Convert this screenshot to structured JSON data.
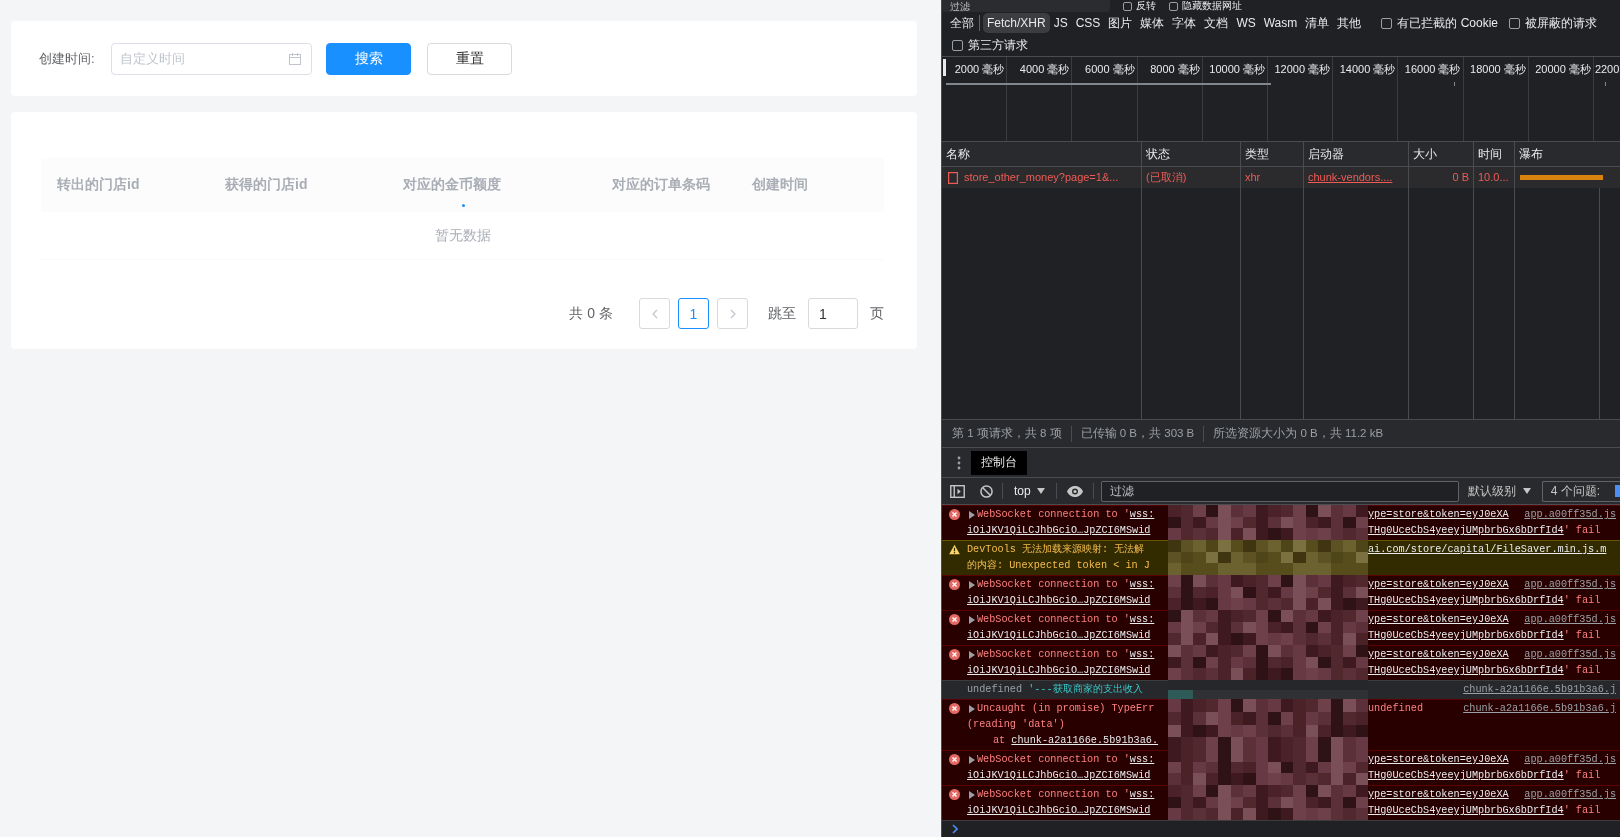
{
  "page": {
    "filter": {
      "label": "创建时间:",
      "date_placeholder": "自定义时间",
      "search_button": "搜索",
      "reset_button": "重置"
    },
    "table": {
      "loading": true,
      "columns": [
        "转出的门店id",
        "获得的门店id",
        "对应的金币额度",
        "对应的订单条码",
        "创建时间"
      ],
      "empty_text": "暂无数据"
    },
    "pagination": {
      "total": "共 0 条",
      "prev_disabled": true,
      "next_disabled": true,
      "pages": [
        {
          "label": "1",
          "selected": true
        }
      ],
      "jump_label": "跳至",
      "jump_value": "1",
      "page_suffix": "页"
    }
  },
  "devtools": {
    "network": {
      "filter_placeholder": "过滤",
      "top_checkboxes": [
        {
          "label": "反转",
          "checked": false
        },
        {
          "label": "隐藏数据网址",
          "checked": false
        }
      ],
      "type_filters": [
        {
          "label": "全部",
          "selected": false
        },
        {
          "label": "Fetch/XHR",
          "selected": true
        },
        {
          "label": "JS",
          "selected": false
        },
        {
          "label": "CSS",
          "selected": false
        },
        {
          "label": "图片",
          "selected": false
        },
        {
          "label": "媒体",
          "selected": false
        },
        {
          "label": "字体",
          "selected": false
        },
        {
          "label": "文档",
          "selected": false
        },
        {
          "label": "WS",
          "selected": false
        },
        {
          "label": "Wasm",
          "selected": false
        },
        {
          "label": "清单",
          "selected": false
        },
        {
          "label": "其他",
          "selected": false
        }
      ],
      "option_checkboxes": [
        {
          "label": "有已拦截的 Cookie",
          "checked": false
        },
        {
          "label": "被屏蔽的请求",
          "checked": false
        }
      ],
      "second_row_checkboxes": [
        {
          "label": "第三方请求",
          "checked": false
        }
      ],
      "timeline_ticks": [
        "2000 毫秒",
        "4000 毫秒",
        "6000 毫秒",
        "8000 毫秒",
        "10000 毫秒",
        "12000 毫秒",
        "14000 毫秒",
        "16000 毫秒",
        "18000 毫秒",
        "20000 毫秒",
        "2200"
      ],
      "columns": [
        "名称",
        "状态",
        "类型",
        "启动器",
        "大小",
        "时间",
        "瀑布"
      ],
      "requests": [
        {
          "name": "store_other_money?page=1&...",
          "status": "(已取消)",
          "type": "xhr",
          "initiator": "chunk-vendors....",
          "size": "0 B",
          "time": "10.0...",
          "failed": true
        }
      ],
      "status_bar": [
        "第 1 项请求，共 8 项",
        "已传输 0 B，共 303 B",
        "所选资源大小为 0 B，共 11.2 kB"
      ]
    },
    "drawer_tabs": [
      {
        "label": "控制台",
        "selected": true
      }
    ],
    "console": {
      "context": "top",
      "filter_placeholder": "过滤",
      "level": "默认级别",
      "issues": "4 个问题:",
      "messages": [
        {
          "kind": "error",
          "expandable": true,
          "redacted": true,
          "source": "app.a00ff35d.js",
          "lines": [
            {
              "before": [
                {
                  "kind": "text",
                  "text": "WebSocket connection to '"
                },
                {
                  "kind": "link",
                  "text": "wss:"
                }
              ],
              "after": [
                {
                  "kind": "link",
                  "text": "ype=store&token=eyJ0eXA"
                }
              ]
            },
            {
              "before": [
                {
                  "kind": "link",
                  "text": "iOiJKV1QiLCJhbGciO…JpZCI6MSwid"
                }
              ],
              "after": [
                {
                  "kind": "link",
                  "text": "THg0UceCbS4yeeyjUMpbrbGx6bDrfId4"
                },
                {
                  "kind": "text",
                  "text": "' fail"
                }
              ]
            }
          ]
        },
        {
          "kind": "warning",
          "expandable": false,
          "redacted": true,
          "lines": [
            {
              "before": [
                {
                  "kind": "text",
                  "text": "DevTools 无法加载来源映射: 无法解"
                }
              ],
              "after": [
                {
                  "kind": "link",
                  "text": "ai.com/store/capital/FileSaver.min.js.m"
                }
              ]
            },
            {
              "before": [
                {
                  "kind": "text",
                  "text": "的内容: Unexpected token < in J"
                }
              ]
            }
          ]
        },
        {
          "kind": "error",
          "expandable": true,
          "redacted": true,
          "source": "app.a00ff35d.js",
          "lines": [
            {
              "before": [
                {
                  "kind": "text",
                  "text": "WebSocket connection to '"
                },
                {
                  "kind": "link",
                  "text": "wss:"
                }
              ],
              "after": [
                {
                  "kind": "link",
                  "text": "ype=store&token=eyJ0eXA"
                }
              ]
            },
            {
              "before": [
                {
                  "kind": "link",
                  "text": "iOiJKV1QiLCJhbGciO…JpZCI6MSwid"
                }
              ],
              "after": [
                {
                  "kind": "link",
                  "text": "THg0UceCbS4yeeyjUMpbrbGx6bDrfId4"
                },
                {
                  "kind": "text",
                  "text": "' fail"
                }
              ]
            }
          ]
        },
        {
          "kind": "error",
          "expandable": true,
          "redacted": true,
          "source": "app.a00ff35d.js",
          "lines": [
            {
              "before": [
                {
                  "kind": "text",
                  "text": "WebSocket connection to '"
                },
                {
                  "kind": "link",
                  "text": "wss:"
                }
              ],
              "after": [
                {
                  "kind": "link",
                  "text": "ype=store&token=eyJ0eXA"
                }
              ]
            },
            {
              "before": [
                {
                  "kind": "link",
                  "text": "iOiJKV1QiLCJhbGciO…JpZCI6MSwid"
                }
              ],
              "after": [
                {
                  "kind": "link",
                  "text": "THg0UceCbS4yeeyjUMpbrbGx6bDrfId4"
                },
                {
                  "kind": "text",
                  "text": "' fail"
                }
              ]
            }
          ]
        },
        {
          "kind": "error",
          "expandable": true,
          "redacted": true,
          "source": "app.a00ff35d.js",
          "lines": [
            {
              "before": [
                {
                  "kind": "text",
                  "text": "WebSocket connection to '"
                },
                {
                  "kind": "link",
                  "text": "wss:"
                }
              ],
              "after": [
                {
                  "kind": "link",
                  "text": "ype=store&token=eyJ0eXA"
                }
              ]
            },
            {
              "before": [
                {
                  "kind": "link",
                  "text": "iOiJKV1QiLCJhbGciO…JpZCI6MSwid"
                }
              ],
              "after": [
                {
                  "kind": "link",
                  "text": "THg0UceCbS4yeeyjUMpbrbGx6bDrfId4"
                },
                {
                  "kind": "text",
                  "text": "' fail"
                }
              ]
            }
          ]
        },
        {
          "kind": "log",
          "expandable": false,
          "redacted": true,
          "source": "chunk-a2a1166e.5b91b3a6.j",
          "lines": [
            {
              "before": [
                {
                  "kind": "muted",
                  "text": "undefined"
                },
                {
                  "kind": "string",
                  "text": "'---获取商家的支出收入"
                }
              ]
            }
          ]
        },
        {
          "kind": "error",
          "expandable": true,
          "redacted": true,
          "source": "chunk-a2a1166e.5b91b3a6.j",
          "lines": [
            {
              "before": [
                {
                  "kind": "text",
                  "text": "Uncaught (in promise) TypeErr"
                }
              ],
              "after": [
                {
                  "kind": "text",
                  "text": "undefined"
                }
              ]
            },
            {
              "before": [
                {
                  "kind": "text",
                  "text": "(reading 'data')"
                }
              ]
            },
            {
              "before": [
                {
                  "kind": "stack",
                  "text": "at"
                },
                {
                  "kind": "link",
                  "text": "chunk-a2a1166e.5b91b3a6."
                }
              ]
            }
          ]
        },
        {
          "kind": "error",
          "expandable": true,
          "redacted": true,
          "source": "app.a00ff35d.js",
          "lines": [
            {
              "before": [
                {
                  "kind": "text",
                  "text": "WebSocket connection to '"
                },
                {
                  "kind": "link",
                  "text": "wss:"
                }
              ],
              "after": [
                {
                  "kind": "link",
                  "text": "ype=store&token=eyJ0eXA"
                }
              ]
            },
            {
              "before": [
                {
                  "kind": "link",
                  "text": "iOiJKV1QiLCJhbGciO…JpZCI6MSwid"
                }
              ],
              "after": [
                {
                  "kind": "link",
                  "text": "THg0UceCbS4yeeyjUMpbrbGx6bDrfId4"
                },
                {
                  "kind": "text",
                  "text": "' fail"
                }
              ]
            }
          ]
        },
        {
          "kind": "error",
          "expandable": true,
          "redacted": true,
          "source": "app.a00ff35d.js",
          "lines": [
            {
              "before": [
                {
                  "kind": "text",
                  "text": "WebSocket connection to '"
                },
                {
                  "kind": "link",
                  "text": "wss:"
                }
              ],
              "after": [
                {
                  "kind": "link",
                  "text": "ype=store&token=eyJ0eXA"
                }
              ]
            },
            {
              "before": [
                {
                  "kind": "link",
                  "text": "iOiJKV1QiLCJhbGciO…JpZCI6MSwid"
                }
              ],
              "after": [
                {
                  "kind": "link",
                  "text": "THg0UceCbS4yeeyjUMpbrbGx6bDrfId4"
                },
                {
                  "kind": "text",
                  "text": "' fail"
                }
              ]
            }
          ]
        }
      ]
    }
  }
}
